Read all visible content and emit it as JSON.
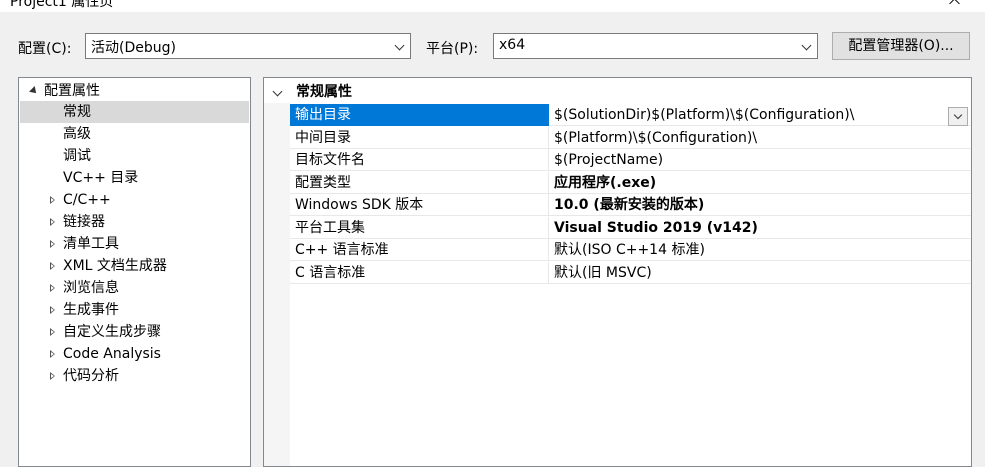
{
  "window": {
    "title": "Project1 属性页"
  },
  "toolbar": {
    "config_label": "配置(C):",
    "config_value": "活动(Debug)",
    "platform_label": "平台(P):",
    "platform_value": "x64",
    "manager_button": "配置管理器(O)..."
  },
  "tree": {
    "root": {
      "label": "配置属性",
      "expanded": true
    },
    "items": [
      {
        "label": "常规",
        "selected": true
      },
      {
        "label": "高级"
      },
      {
        "label": "调试"
      },
      {
        "label": "VC++ 目录"
      },
      {
        "label": "C/C++",
        "collapsed": true
      },
      {
        "label": "链接器",
        "collapsed": true
      },
      {
        "label": "清单工具",
        "collapsed": true
      },
      {
        "label": "XML 文档生成器",
        "collapsed": true
      },
      {
        "label": "浏览信息",
        "collapsed": true
      },
      {
        "label": "生成事件",
        "collapsed": true
      },
      {
        "label": "自定义生成步骤",
        "collapsed": true
      },
      {
        "label": "Code Analysis",
        "collapsed": true
      },
      {
        "label": "代码分析",
        "collapsed": true
      }
    ]
  },
  "grid": {
    "category": "常规属性",
    "rows": [
      {
        "name": "输出目录",
        "value": "$(SolutionDir)$(Platform)\\$(Configuration)\\",
        "selected": true
      },
      {
        "name": "中间目录",
        "value": "$(Platform)\\$(Configuration)\\"
      },
      {
        "name": "目标文件名",
        "value": "$(ProjectName)"
      },
      {
        "name": "配置类型",
        "value": "应用程序(.exe)",
        "bold": true
      },
      {
        "name": "Windows SDK 版本",
        "value": "10.0 (最新安装的版本)",
        "bold": true
      },
      {
        "name": "平台工具集",
        "value": "Visual Studio 2019 (v142)",
        "bold": true
      },
      {
        "name": "C++ 语言标准",
        "value": "默认(ISO C++14 标准)"
      },
      {
        "name": "C 语言标准",
        "value": "默认(旧 MSVC)"
      }
    ]
  },
  "colors": {
    "selection_accent": "#0078d7",
    "tree_selection": "#d9d9d9",
    "window_bg": "#f0f0f0"
  },
  "icons": {
    "tree_expanded": "triangle-down-icon",
    "tree_collapsed": "triangle-right-icon",
    "combo_arrow": "chevron-down-icon"
  }
}
